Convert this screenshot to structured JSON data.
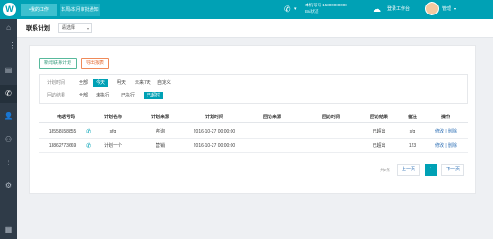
{
  "app": {
    "logo_glyph": "W"
  },
  "topbar": {
    "tab_workbench": "•我的工作",
    "tab_pending": "本周/本月审批通知",
    "phone_icon": "phone-icon",
    "phone_number": "本机号码 15800000000",
    "status": "Bai状态",
    "login_label": "登录工作台",
    "user_name": "管理"
  },
  "sidebar": {
    "items": [
      {
        "icon": "home-icon",
        "glyph": "⌂"
      },
      {
        "icon": "grid-icon",
        "glyph": "⋮⋮"
      },
      {
        "icon": "report-icon",
        "glyph": "▤"
      },
      {
        "icon": "phone-icon",
        "glyph": "✆"
      },
      {
        "icon": "person-icon",
        "glyph": "👤"
      },
      {
        "icon": "team-icon",
        "glyph": "⚇"
      },
      {
        "icon": "chart-icon",
        "glyph": "⫶"
      },
      {
        "icon": "settings-icon",
        "glyph": "⚙"
      },
      {
        "icon": "message-icon",
        "glyph": "▦"
      }
    ],
    "active_index": 3
  },
  "header": {
    "title": "联系计划",
    "select_value": "请选择"
  },
  "actions": {
    "add_label": "新增联系计划",
    "export_label": "导出报表"
  },
  "filters": {
    "time": {
      "label": "计划时间",
      "options": [
        "全部",
        "今天",
        "明天",
        "未来7天",
        "自定义"
      ],
      "active_index": 1
    },
    "status": {
      "label": "回访结果",
      "options": [
        "全部",
        "未执行",
        "已执行",
        "已超时"
      ],
      "active_index": 3
    }
  },
  "table": {
    "headers": [
      "电话号码",
      "计划名称",
      "计划来源",
      "计划时间",
      "回访来源",
      "回访时间",
      "回访结果",
      "备注",
      "操作"
    ],
    "rows": [
      {
        "phone": "18558558855",
        "plan_name": "sfg",
        "source": "咨询",
        "time": "2016-10-27 00:00:00",
        "visit_source": "",
        "visit_time": "",
        "result": "已超出",
        "note": "sfg",
        "ops": "修改 | 删除"
      },
      {
        "phone": "13862773669",
        "plan_name": "计划一个",
        "source": "营销",
        "time": "2016-10-27 00:00:00",
        "visit_source": "",
        "visit_time": "",
        "result": "已超出",
        "note": "123",
        "ops": "修改 | 删除"
      }
    ]
  },
  "pagination": {
    "total_label": "共2条",
    "prev": "上一页",
    "current": "1",
    "next": "下一页"
  },
  "colors": {
    "brand": "#00a1b5",
    "sidebar": "#2f3b48",
    "add_button": "#58b99c",
    "export_button": "#ef8a59"
  }
}
